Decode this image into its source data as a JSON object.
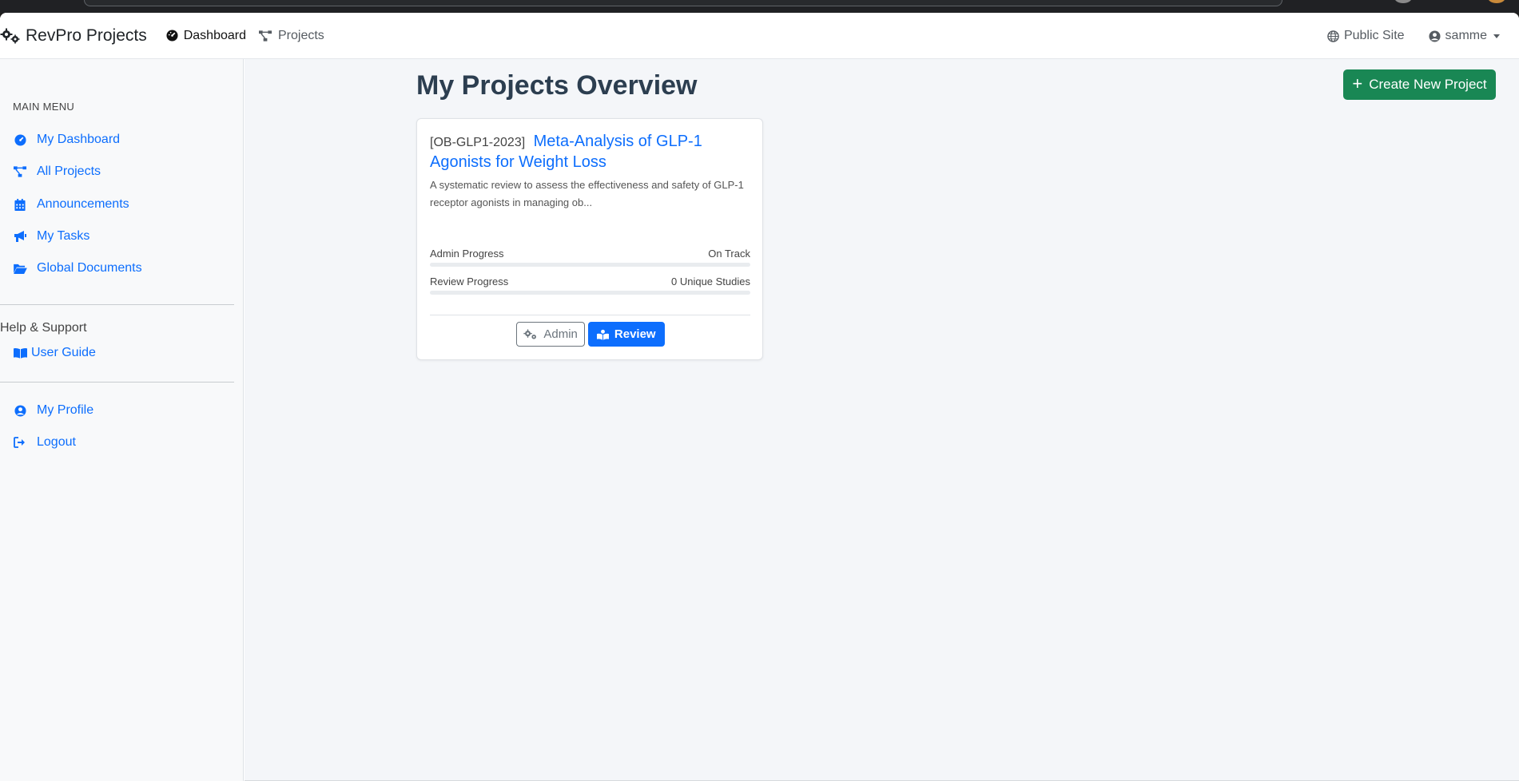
{
  "navbar": {
    "brand": "RevPro Projects",
    "links": [
      {
        "label": "Dashboard",
        "icon": "gauge-icon"
      },
      {
        "label": "Projects",
        "icon": "project-diagram-icon"
      }
    ],
    "public_site": "Public Site",
    "user": "samme"
  },
  "sidebar": {
    "main_menu_heading": "MAIN MENU",
    "main_items": [
      {
        "label": "My Dashboard",
        "icon": "gauge-icon"
      },
      {
        "label": "All Projects",
        "icon": "project-diagram-icon"
      },
      {
        "label": "Announcements",
        "icon": "calendar-icon"
      },
      {
        "label": "My Tasks",
        "icon": "megaphone-icon"
      },
      {
        "label": "Global Documents",
        "icon": "folder-open-icon"
      }
    ],
    "help_heading": "Help & Support",
    "help_items": [
      {
        "label": "User Guide",
        "icon": "book-icon"
      }
    ],
    "account_items": [
      {
        "label": "My Profile",
        "icon": "user-circle-icon"
      },
      {
        "label": "Logout",
        "icon": "sign-out-icon"
      }
    ]
  },
  "main": {
    "title": "My Projects Overview",
    "create_button": "Create New Project",
    "projects": [
      {
        "code": "[OB-GLP1-2023]",
        "name": "Meta-Analysis of GLP-1 Agonists for Weight Loss",
        "description": "A systematic review to assess the effectiveness and safety of GLP-1 receptor agonists in managing ob...",
        "admin_progress_label": "Admin Progress",
        "admin_progress_status": "On Track",
        "admin_progress_value": 0,
        "review_progress_label": "Review Progress",
        "review_progress_status": "0 Unique Studies",
        "review_progress_value": 0,
        "admin_button": "Admin",
        "review_button": "Review"
      }
    ]
  },
  "colors": {
    "primary": "#0d6efd",
    "success": "#198754",
    "title": "#2c3e50"
  }
}
